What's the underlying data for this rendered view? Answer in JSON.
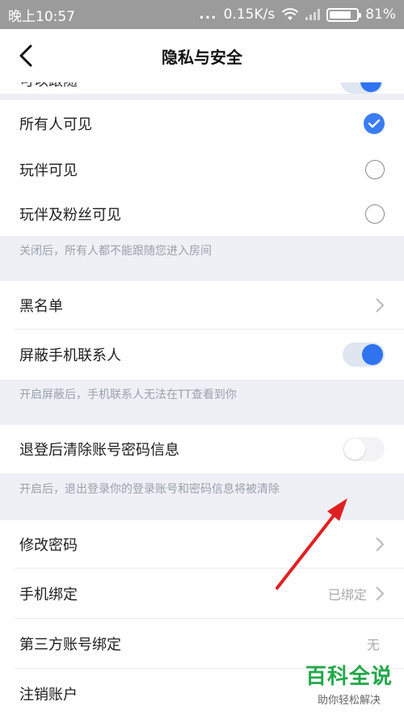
{
  "status": {
    "time": "晚上10:57",
    "dots": "...",
    "speed": "0.15K/s",
    "battery": "81%",
    "battery_level": 0.81
  },
  "nav": {
    "title": "隐私与安全"
  },
  "visibility": {
    "clipped_label": "可以跟随",
    "options": [
      {
        "label": "所有人可见",
        "selected": true
      },
      {
        "label": "玩伴可见",
        "selected": false
      },
      {
        "label": "玩伴及粉丝可见",
        "selected": false
      }
    ],
    "note": "关闭后，所有人都不能跟随您进入房间"
  },
  "blacklist": {
    "label": "黑名单"
  },
  "block_contacts": {
    "label": "屏蔽手机联系人",
    "on": true,
    "note": "开启屏蔽后，手机联系人无法在TT查看到你"
  },
  "clear_on_logout": {
    "label": "退登后清除账号密码信息",
    "on": false,
    "note": "开启后，退出登录你的登录账号和密码信息将被清除"
  },
  "account": {
    "change_password": "修改密码",
    "phone_binding": "手机绑定",
    "phone_binding_status": "已绑定",
    "third_party": "第三方账号绑定",
    "third_party_status": "无",
    "deactivate": "注销账户"
  },
  "watermark": {
    "title": "百科全说",
    "subtitle": "助你轻松解决"
  },
  "colors": {
    "accent": "#3a7cf2",
    "annotation_arrow": "#e02020",
    "watermark": "#22a84a"
  }
}
